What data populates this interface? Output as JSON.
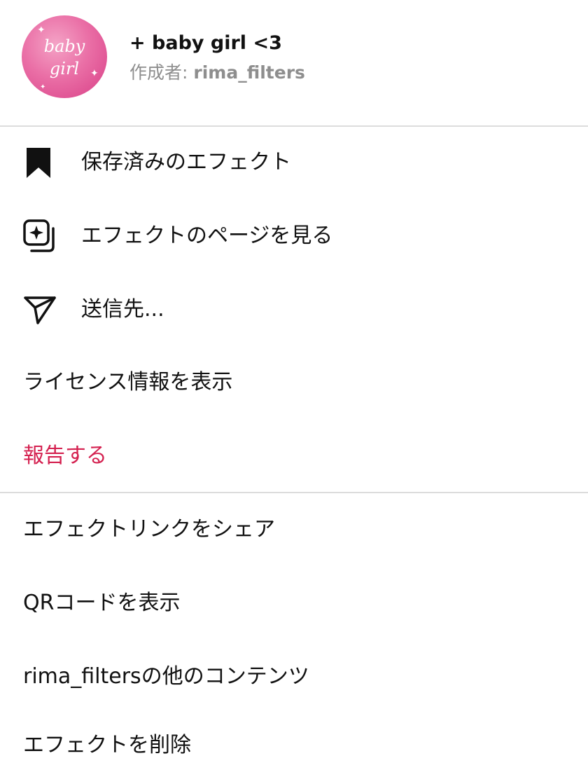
{
  "effect": {
    "avatar_line1": "baby",
    "avatar_line2": "girl",
    "title": "+ baby girl <3",
    "creator_prefix": "作成者: ",
    "creator_handle": "rima_filters"
  },
  "menu_primary": {
    "saved_effects": "保存済みのエフェクト",
    "view_effect_page": "エフェクトのページを見る",
    "send_to": "送信先...",
    "view_license": "ライセンス情報を表示",
    "report": "報告する"
  },
  "menu_secondary": {
    "share_link": "エフェクトリンクをシェア",
    "show_qr": "QRコードを表示",
    "more_content": "rima_filtersの他のコンテンツ",
    "delete_effect": "エフェクトを削除"
  },
  "icons": {
    "saved": "bookmark-icon",
    "effect_page": "effect-page-icon",
    "send": "paper-plane-icon"
  },
  "colors": {
    "danger": "#d4204f",
    "secondary_text": "#8e8e8e",
    "divider": "#dcdcdc"
  }
}
